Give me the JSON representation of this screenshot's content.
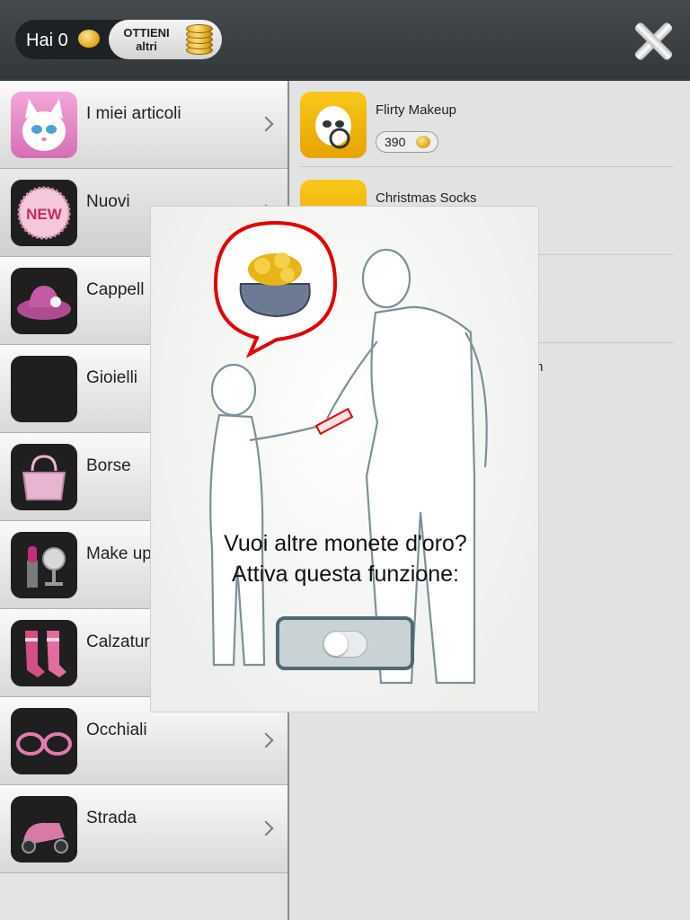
{
  "header": {
    "coins_label": "Hai 0",
    "get_more_line1": "OTTIENI",
    "get_more_line2": "altri"
  },
  "categories": [
    {
      "label": "I miei articoli",
      "icon": "talking-angela-icon"
    },
    {
      "label": "Nuovi",
      "icon": "new-badge-icon",
      "badge": "NEW"
    },
    {
      "label": "Cappell",
      "icon": "hat-icon"
    },
    {
      "label": "Gioielli",
      "icon": "jewelry-icon"
    },
    {
      "label": "Borse",
      "icon": "handbag-icon"
    },
    {
      "label": "Make up",
      "icon": "makeup-icon"
    },
    {
      "label": "Calzatur",
      "icon": "socks-icon"
    },
    {
      "label": "Occhiali",
      "icon": "glasses-icon"
    },
    {
      "label": "Strada",
      "icon": "scooter-icon"
    }
  ],
  "items": [
    {
      "name": "Flirty Makeup",
      "price": "390"
    },
    {
      "name": "Christmas Socks"
    }
  ],
  "partial_item_suffix": "m",
  "popup": {
    "title": "Vuoi altre monete d'oro?",
    "subtitle": "Attiva questa funzione:",
    "toggle_on": false
  },
  "colors": {
    "topbar": "#3d4245",
    "toggle_border": "#4f6a73",
    "bubble_border": "#e00000"
  }
}
